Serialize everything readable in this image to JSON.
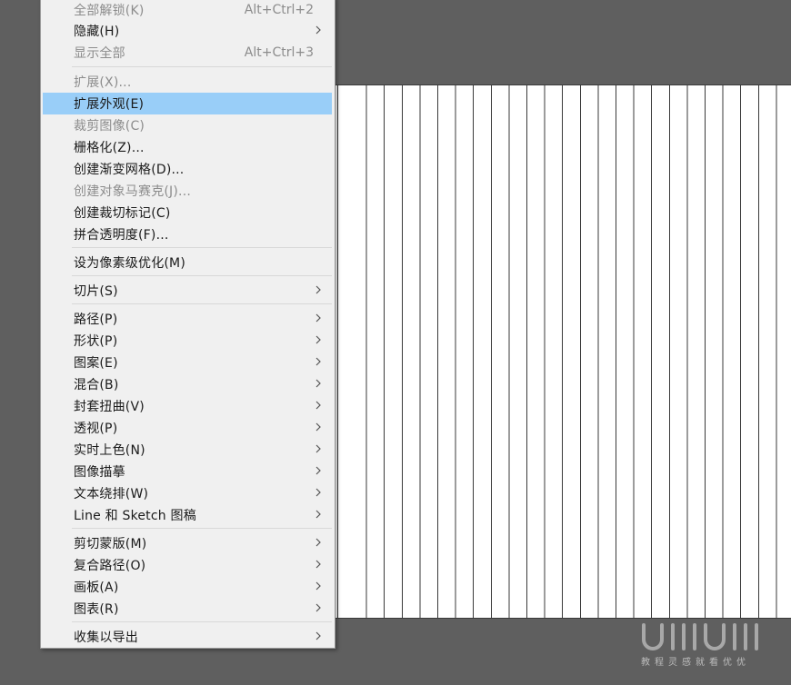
{
  "menu": {
    "items": [
      {
        "label": "全部解锁(K)",
        "shortcut": "Alt+Ctrl+2",
        "disabled": true,
        "submenu": false
      },
      {
        "label": "隐藏(H)",
        "shortcut": "",
        "disabled": false,
        "submenu": true
      },
      {
        "label": "显示全部",
        "shortcut": "Alt+Ctrl+3",
        "disabled": true,
        "submenu": false
      },
      {
        "label": "扩展(X)...",
        "shortcut": "",
        "disabled": true,
        "submenu": false
      },
      {
        "label": "扩展外观(E)",
        "shortcut": "",
        "disabled": false,
        "submenu": false,
        "highlighted": true
      },
      {
        "label": "裁剪图像(C)",
        "shortcut": "",
        "disabled": true,
        "submenu": false
      },
      {
        "label": "栅格化(Z)...",
        "shortcut": "",
        "disabled": false,
        "submenu": false
      },
      {
        "label": "创建渐变网格(D)...",
        "shortcut": "",
        "disabled": false,
        "submenu": false
      },
      {
        "label": "创建对象马赛克(J)...",
        "shortcut": "",
        "disabled": true,
        "submenu": false
      },
      {
        "label": "创建裁切标记(C)",
        "shortcut": "",
        "disabled": false,
        "submenu": false
      },
      {
        "label": "拼合透明度(F)...",
        "shortcut": "",
        "disabled": false,
        "submenu": false
      },
      {
        "label": "设为像素级优化(M)",
        "shortcut": "",
        "disabled": false,
        "submenu": false
      },
      {
        "label": "切片(S)",
        "shortcut": "",
        "disabled": false,
        "submenu": true
      },
      {
        "label": "路径(P)",
        "shortcut": "",
        "disabled": false,
        "submenu": true
      },
      {
        "label": "形状(P)",
        "shortcut": "",
        "disabled": false,
        "submenu": true
      },
      {
        "label": "图案(E)",
        "shortcut": "",
        "disabled": false,
        "submenu": true
      },
      {
        "label": "混合(B)",
        "shortcut": "",
        "disabled": false,
        "submenu": true
      },
      {
        "label": "封套扭曲(V)",
        "shortcut": "",
        "disabled": false,
        "submenu": true
      },
      {
        "label": "透视(P)",
        "shortcut": "",
        "disabled": false,
        "submenu": true
      },
      {
        "label": "实时上色(N)",
        "shortcut": "",
        "disabled": false,
        "submenu": true
      },
      {
        "label": "图像描摹",
        "shortcut": "",
        "disabled": false,
        "submenu": true
      },
      {
        "label": "文本绕排(W)",
        "shortcut": "",
        "disabled": false,
        "submenu": true
      },
      {
        "label": "Line 和 Sketch 图稿",
        "shortcut": "",
        "disabled": false,
        "submenu": true
      },
      {
        "label": "剪切蒙版(M)",
        "shortcut": "",
        "disabled": false,
        "submenu": true
      },
      {
        "label": "复合路径(O)",
        "shortcut": "",
        "disabled": false,
        "submenu": true
      },
      {
        "label": "画板(A)",
        "shortcut": "",
        "disabled": false,
        "submenu": true
      },
      {
        "label": "图表(R)",
        "shortcut": "",
        "disabled": false,
        "submenu": true
      },
      {
        "label": "收集以导出",
        "shortcut": "",
        "disabled": false,
        "submenu": true
      }
    ]
  },
  "watermark": {
    "logo_text": "UIIIUIII",
    "caption": "教程灵感就看优优"
  },
  "colors": {
    "workspace": "#5f5f5f",
    "menu_background": "#f0f0f0",
    "highlight": "#99cef8",
    "disabled_text": "#8c8c8c",
    "text": "#1a1a1a"
  }
}
